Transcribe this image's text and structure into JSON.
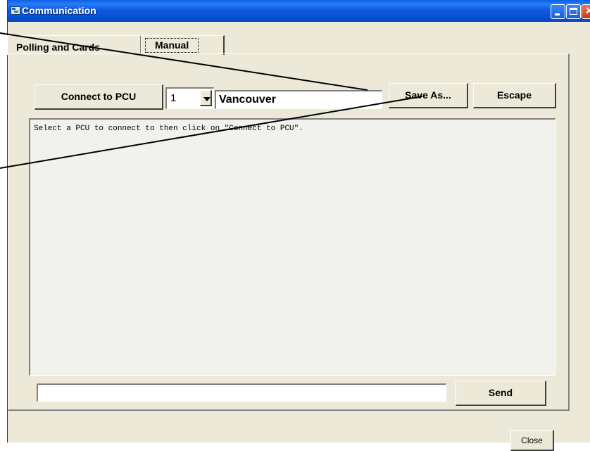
{
  "window": {
    "title": "Communication"
  },
  "tabs": [
    {
      "label": "Polling and Cards",
      "selected": false
    },
    {
      "label": "Manual",
      "selected": true
    }
  ],
  "toolbar": {
    "connect_label": "Connect to PCU",
    "pcu_number": "1",
    "location": "Vancouver",
    "save_as_label": "Save As...",
    "escape_label": "Escape"
  },
  "log": {
    "text": "Select a PCU to connect to then click on \"Connect to PCU\"."
  },
  "send": {
    "input_value": "",
    "button_label": "Send"
  },
  "footer": {
    "close_label": "Close"
  }
}
